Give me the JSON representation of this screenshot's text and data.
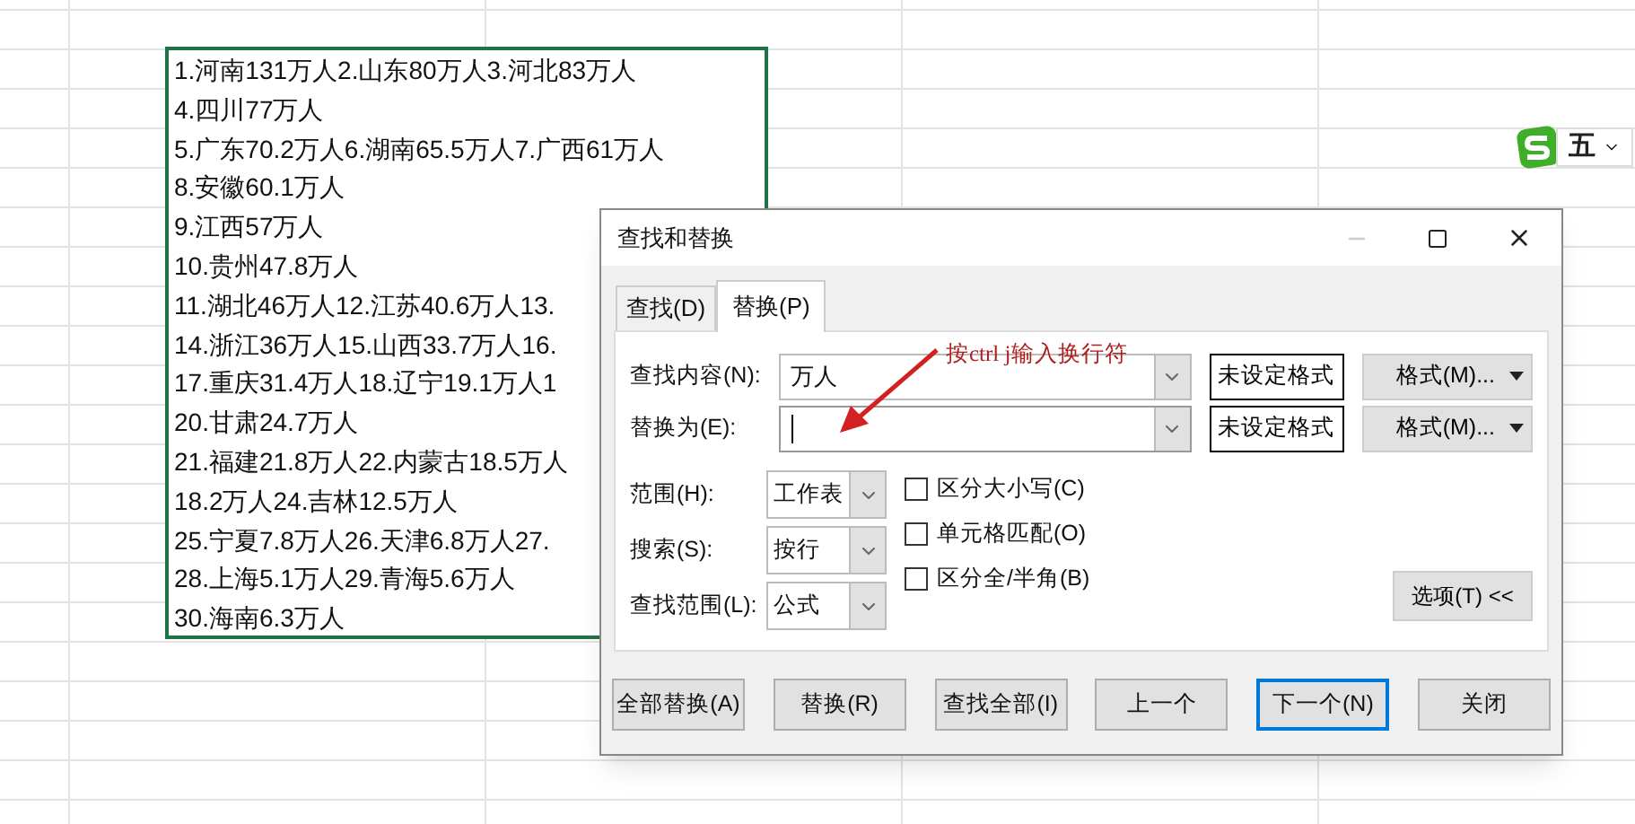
{
  "sheet": {
    "cell_lines": [
      "1.河南131万人2.山东80万人3.河北83万人",
      "4.四川77万人",
      "5.广东70.2万人6.湖南65.5万人7.广西61万人",
      "8.安徽60.1万人",
      "9.江西57万人",
      "10.贵州47.8万人",
      "11.湖北46万人12.江苏40.6万人13.",
      "14.浙江36万人15.山西33.7万人16.",
      "17.重庆31.4万人18.辽宁19.1万人1",
      "20.甘肃24.7万人",
      "21.福建21.8万人22.内蒙古18.5万人",
      "18.2万人24.吉林12.5万人",
      "25.宁夏7.8万人26.天津6.8万人27.",
      "28.上海5.1万人29.青海5.6万人",
      "30.海南6.3万人"
    ]
  },
  "ime": {
    "label": "五"
  },
  "dialog": {
    "title": "查找和替换",
    "tabs": [
      {
        "label": "查找(D)",
        "selected": false
      },
      {
        "label": "替换(P)",
        "selected": true
      }
    ],
    "fields": [
      {
        "label": "查找内容(N):",
        "value": "万人",
        "focused": false,
        "format_status": "未设定格式",
        "format_button": "格式(M)..."
      },
      {
        "label": "替换为(E):",
        "focused": true,
        "format_status": "未设定格式",
        "format_button": "格式(M)..."
      }
    ],
    "selects": [
      {
        "label": "范围(H):",
        "value": "工作表"
      },
      {
        "label": "搜索(S):",
        "value": "按行"
      },
      {
        "label": "查找范围(L):",
        "value": "公式"
      }
    ],
    "checkboxes": [
      {
        "label": "区分大小写(C)",
        "checked": false
      },
      {
        "label": "单元格匹配(O)",
        "checked": false
      },
      {
        "label": "区分全/半角(B)",
        "checked": false
      }
    ],
    "options_button": "选项(T) <<",
    "buttons": [
      {
        "label": "全部替换(A)",
        "default": false
      },
      {
        "label": "替换(R)",
        "default": false
      },
      {
        "label": "查找全部(I)",
        "default": false
      },
      {
        "label": "上一个",
        "default": false
      },
      {
        "label": "下一个(N)",
        "default": true
      },
      {
        "label": "关闭",
        "default": false
      }
    ]
  },
  "annotation": {
    "text": "按ctrl j输入换行符"
  }
}
